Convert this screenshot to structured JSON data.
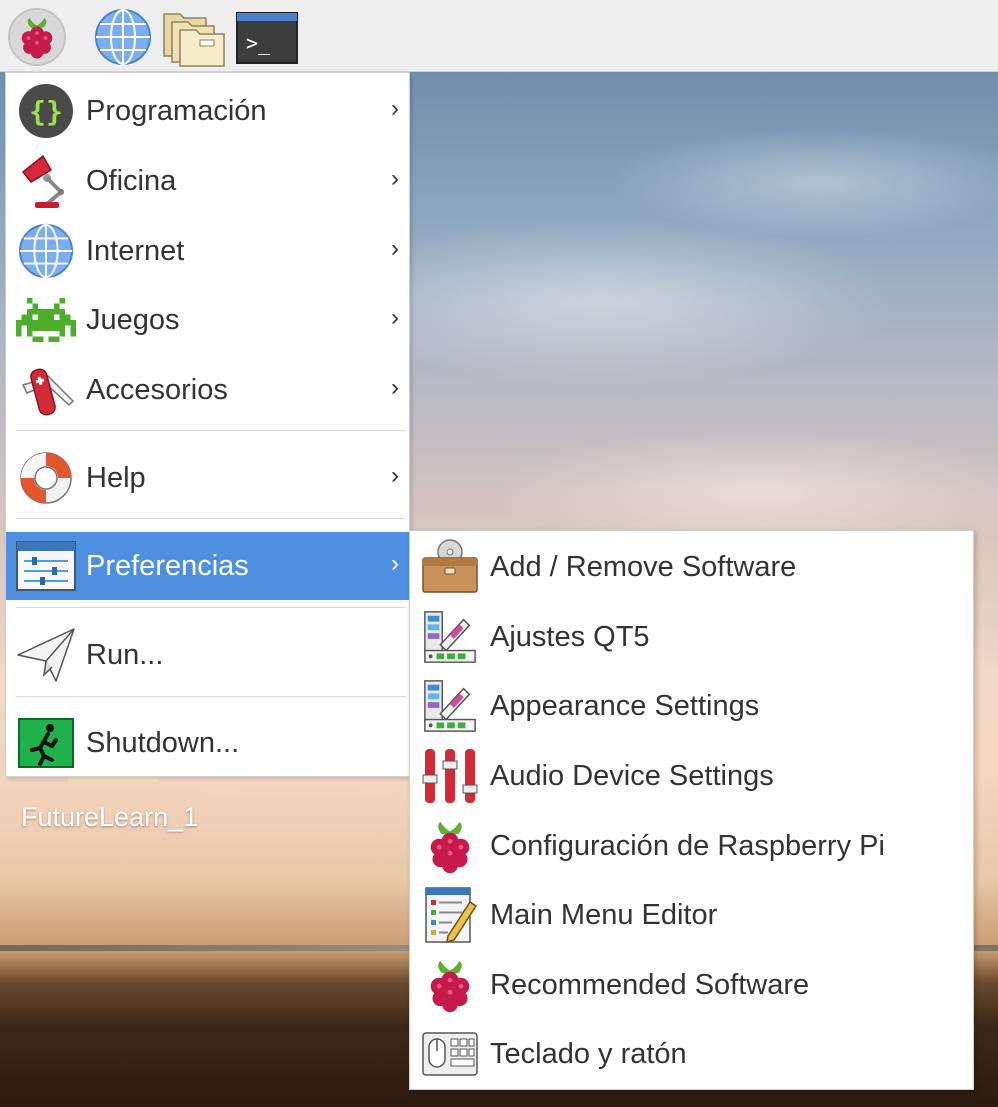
{
  "desktop": {
    "icons": [
      {
        "label": "FutureLearn_1"
      }
    ]
  },
  "taskbar": {
    "buttons": [
      {
        "icon": "raspberry-icon"
      },
      {
        "icon": "globe-icon"
      },
      {
        "icon": "folders-icon"
      },
      {
        "icon": "terminal-icon",
        "glyph": ">_"
      }
    ]
  },
  "menu": {
    "items": [
      {
        "label": "Programación",
        "icon": "code-braces-icon",
        "has_submenu": true
      },
      {
        "label": "Oficina",
        "icon": "desk-lamp-icon",
        "has_submenu": true
      },
      {
        "label": "Internet",
        "icon": "globe-icon",
        "has_submenu": true
      },
      {
        "label": "Juegos",
        "icon": "space-invader-icon",
        "has_submenu": true
      },
      {
        "label": "Accesorios",
        "icon": "pocket-knife-icon",
        "has_submenu": true
      },
      {
        "label": "Help",
        "icon": "lifebuoy-icon",
        "has_submenu": true
      },
      {
        "label": "Preferencias",
        "icon": "preferences-sliders-icon",
        "has_submenu": true,
        "active": true
      },
      {
        "label": "Run...",
        "icon": "paper-plane-icon",
        "has_submenu": false
      },
      {
        "label": "Shutdown...",
        "icon": "exit-running-man-icon",
        "has_submenu": false
      }
    ],
    "chevron": "›",
    "highlight_color": "#4f8fe0"
  },
  "submenu": {
    "items": [
      {
        "label": "Add / Remove Software",
        "icon": "package-cd-icon"
      },
      {
        "label": "Ajustes QT5",
        "icon": "color-swatches-icon"
      },
      {
        "label": "Appearance Settings",
        "icon": "color-swatches-icon"
      },
      {
        "label": "Audio Device Settings",
        "icon": "audio-mixer-icon"
      },
      {
        "label": "Configuración de Raspberry Pi",
        "icon": "raspberry-icon"
      },
      {
        "label": "Main Menu Editor",
        "icon": "menu-editor-pencil-icon"
      },
      {
        "label": "Recommended Software",
        "icon": "raspberry-icon"
      },
      {
        "label": "Teclado y ratón",
        "icon": "keyboard-mouse-icon"
      }
    ]
  }
}
